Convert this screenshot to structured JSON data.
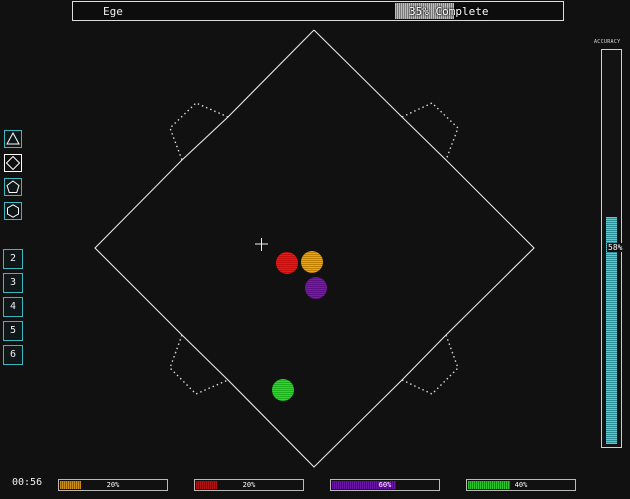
{
  "header": {
    "player_name": "Ege",
    "progress_text": "35% Complete",
    "progress_fraction": 0.35
  },
  "shape_tools": [
    {
      "name": "triangle",
      "icon": "triangle-icon",
      "selected": false
    },
    {
      "name": "diamond",
      "icon": "diamond-icon",
      "selected": true
    },
    {
      "name": "pentagon",
      "icon": "pentagon-icon",
      "selected": false
    },
    {
      "name": "hexagon",
      "icon": "hexagon-icon",
      "selected": false
    }
  ],
  "number_buttons": [
    "2",
    "3",
    "4",
    "5",
    "6"
  ],
  "timer": "00:56",
  "accuracy": {
    "label": "ACCURACY",
    "text": "58%",
    "fraction": 0.58
  },
  "balls": [
    {
      "color": "#ff1010",
      "name": "red"
    },
    {
      "color": "#f5a400",
      "name": "orange"
    },
    {
      "color": "#7b16b0",
      "name": "purple"
    },
    {
      "color": "#22e022",
      "name": "green"
    }
  ],
  "color_bars": [
    {
      "color": "#c98a18",
      "text": "20%",
      "fraction": 0.2
    },
    {
      "color": "#b01515",
      "text": "20%",
      "fraction": 0.2
    },
    {
      "color": "#6a15a8",
      "text": "60%",
      "fraction": 0.6
    },
    {
      "color": "#2ec22e",
      "text": "40%",
      "fraction": 0.4
    }
  ],
  "colors": {
    "accent": "#3fb6c0",
    "background": "#111111"
  }
}
